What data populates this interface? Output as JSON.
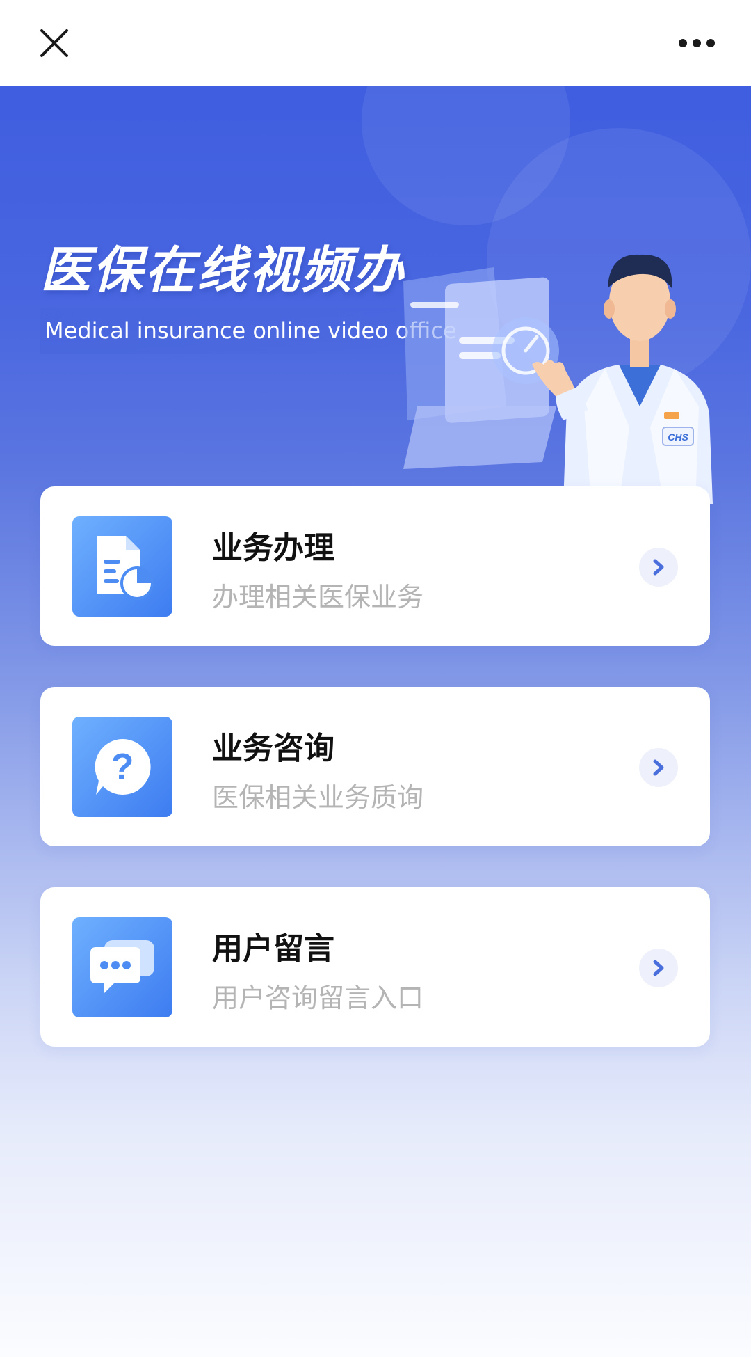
{
  "topbar": {
    "close_icon": "close-icon",
    "more_icon": "more-horizontal-icon"
  },
  "banner": {
    "title": "医保在线视频办",
    "subtitle": "Medical insurance online video office",
    "badge_text": "CHS"
  },
  "menu": [
    {
      "title": "业务办理",
      "description": "办理相关医保业务",
      "icon": "document-chart-icon"
    },
    {
      "title": "业务咨询",
      "description": "医保相关业务质询",
      "icon": "question-bubble-icon"
    },
    {
      "title": "用户留言",
      "description": "用户咨询留言入口",
      "icon": "chat-bubbles-icon"
    }
  ],
  "colors": {
    "primary_blue": "#3f5ee0",
    "icon_gradient_start": "#6fb0ff",
    "icon_gradient_end": "#3d7cf0",
    "card_title": "#111111",
    "card_desc": "#b4b4b4",
    "arrow": "#4a6fdc"
  }
}
